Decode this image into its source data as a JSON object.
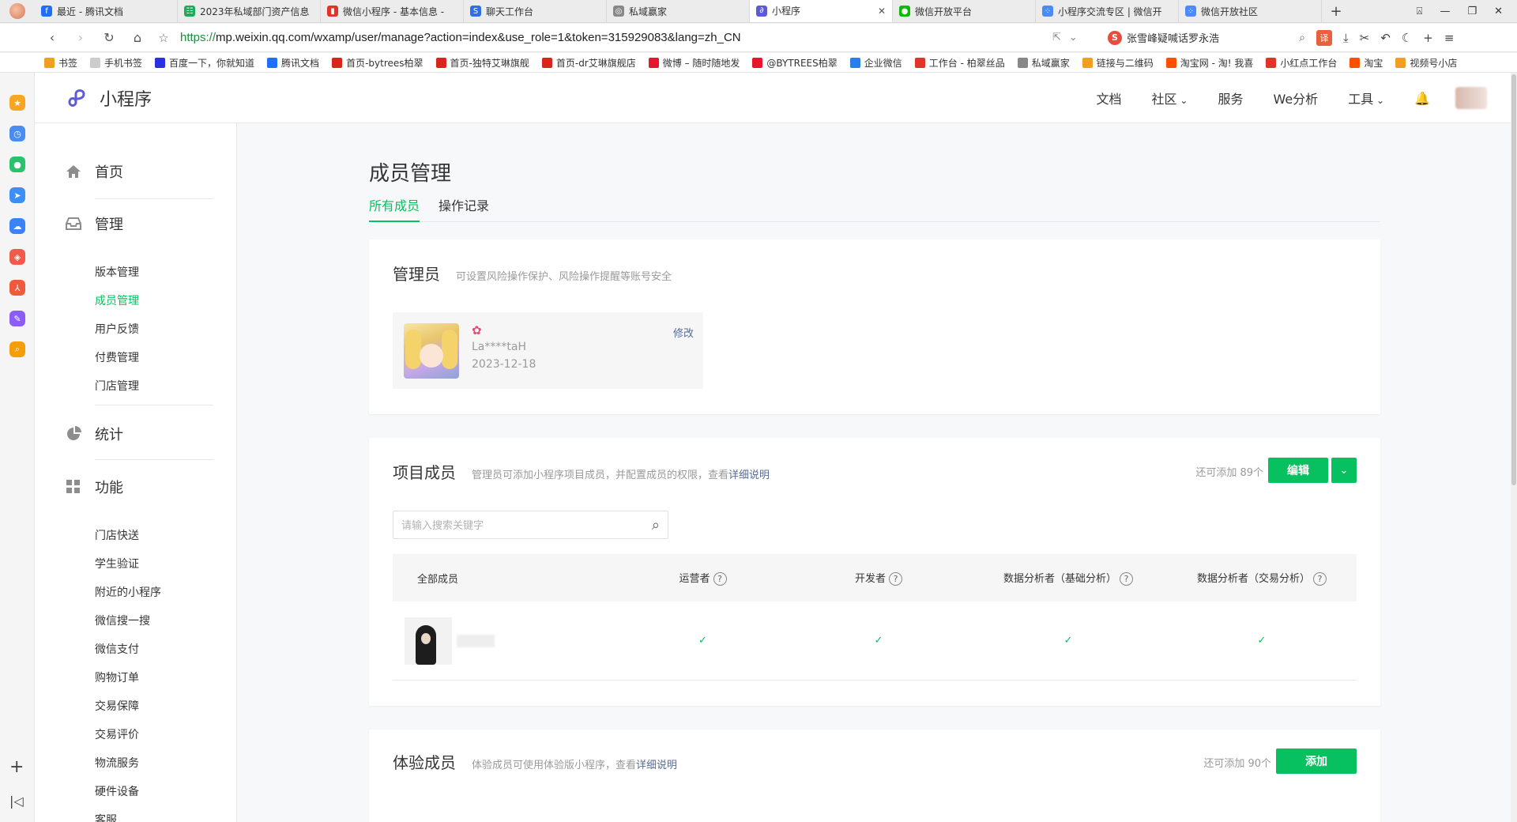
{
  "browser": {
    "tabs": [
      {
        "label": "最近 - 腾讯文档",
        "color": "#1e6fff",
        "glyph": "f"
      },
      {
        "label": "2023年私域部门资产信息",
        "color": "#1aad5b",
        "glyph": "☷"
      },
      {
        "label": "微信小程序 - 基本信息 -",
        "color": "#e0342b",
        "glyph": "▮"
      },
      {
        "label": "聊天工作台",
        "color": "#2f6fe4",
        "glyph": "S"
      },
      {
        "label": "私域赢家",
        "color": "#888888",
        "glyph": "◎"
      },
      {
        "label": "小程序",
        "color": "#5b5bd6",
        "glyph": "∂",
        "active": true
      },
      {
        "label": "微信开放平台",
        "color": "#09bb07",
        "glyph": "●"
      },
      {
        "label": "小程序交流专区 | 微信开",
        "color": "#4b8bf4",
        "glyph": "⁘"
      },
      {
        "label": "微信开放社区",
        "color": "#4b8bf4",
        "glyph": "⁘"
      }
    ],
    "url_scheme": "https://",
    "url_rest": "mp.weixin.qq.com/wxamp/user/manage?action=index&use_role=1&token=315929083&lang=zh_CN",
    "search_text": "张雪峰疑喊话罗永浩",
    "bookmarks": [
      {
        "label": "书签",
        "color": "#f0a020"
      },
      {
        "label": "手机书签",
        "color": "#cccccc"
      },
      {
        "label": "百度一下，你就知道",
        "color": "#2932e1"
      },
      {
        "label": "腾讯文档",
        "color": "#1e6fff"
      },
      {
        "label": "首页-bytrees柏翠",
        "color": "#d9261c"
      },
      {
        "label": "首页-独特艾琳旗舰",
        "color": "#d9261c"
      },
      {
        "label": "首页-dr艾琳旗舰店",
        "color": "#d9261c"
      },
      {
        "label": "微博 – 随时随地发",
        "color": "#e6162d"
      },
      {
        "label": "@BYTREES柏翠",
        "color": "#e6162d"
      },
      {
        "label": "企业微信",
        "color": "#2b7de9"
      },
      {
        "label": "工作台 - 柏翠丝品",
        "color": "#e0342b"
      },
      {
        "label": "私域赢家",
        "color": "#888888"
      },
      {
        "label": "链接与二维码",
        "color": "#f0a020"
      },
      {
        "label": "淘宝网 - 淘! 我喜",
        "color": "#ff5000"
      },
      {
        "label": "小红点工作台",
        "color": "#e0342b"
      },
      {
        "label": "淘宝",
        "color": "#ff5000"
      },
      {
        "label": "视频号小店",
        "color": "#f0a020"
      }
    ]
  },
  "header": {
    "logo_text": "小程序",
    "menu": [
      "文档",
      "社区",
      "服务",
      "We分析",
      "工具"
    ]
  },
  "sidebar": {
    "sections": [
      {
        "label": "首页"
      },
      {
        "label": "管理",
        "items": [
          "版本管理",
          "成员管理",
          "用户反馈",
          "付费管理",
          "门店管理"
        ]
      },
      {
        "label": "统计"
      },
      {
        "label": "功能",
        "items": [
          "门店快送",
          "学生验证",
          "附近的小程序",
          "微信搜一搜",
          "微信支付",
          "购物订单",
          "交易保障",
          "交易评价",
          "物流服务",
          "硬件设备",
          "客服"
        ]
      }
    ],
    "active_item": "成员管理"
  },
  "main": {
    "title": "成员管理",
    "tabs": [
      "所有成员",
      "操作记录"
    ],
    "admin": {
      "title": "管理员",
      "desc": "可设置风险操作保护、风险操作提醒等账号安全",
      "name": "La****taH",
      "date": "2023-12-18",
      "edit_label": "修改"
    },
    "project": {
      "title": "项目成员",
      "desc": "管理员可添加小程序项目成员，并配置成员的权限，查看",
      "link": "详细说明",
      "quota": "还可添加 89个",
      "edit_button": "编辑",
      "search_placeholder": "请输入搜索关键字",
      "columns": [
        "全部成员",
        "运营者",
        "开发者",
        "数据分析者（基础分析）",
        "数据分析者（交易分析）"
      ],
      "rows": [
        {
          "name": "",
          "checks": [
            "✓",
            "✓",
            "✓",
            "✓"
          ]
        }
      ]
    },
    "experience": {
      "title": "体验成员",
      "desc": "体验成员可使用体验版小程序，查看",
      "link": "详细说明",
      "quota": "还可添加 90个",
      "add_button": "添加"
    }
  }
}
